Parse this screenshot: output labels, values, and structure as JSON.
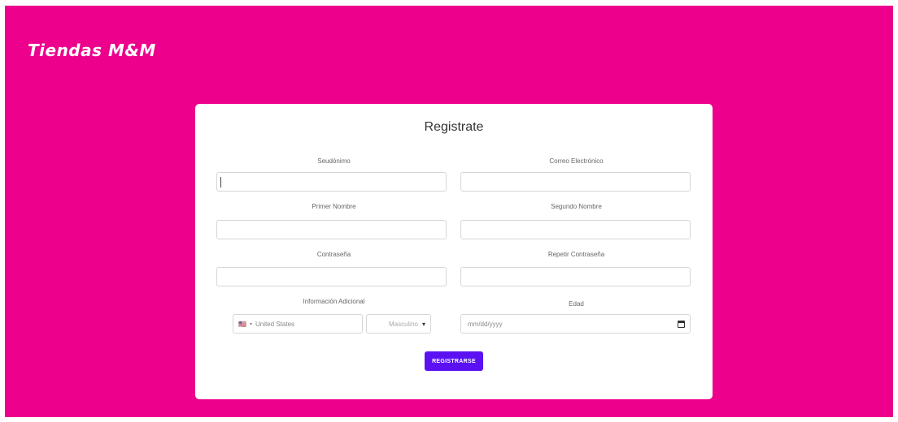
{
  "brand": {
    "name": "Tiendas M&M"
  },
  "form": {
    "title": "Registrate",
    "fields": {
      "username": {
        "label": "Seudónimo",
        "value": ""
      },
      "email": {
        "label": "Correo Electrónico",
        "value": ""
      },
      "first_name": {
        "label": "Primer Nombre",
        "value": ""
      },
      "second_name": {
        "label": "Segundo Nombre",
        "value": ""
      },
      "password": {
        "label": "Contraseña",
        "value": ""
      },
      "repeat_password": {
        "label": "Repetir Contraseña",
        "value": ""
      },
      "additional_info": {
        "label": "Información Adicional"
      },
      "country": {
        "flag": "🇺🇸",
        "value": "United States"
      },
      "gender": {
        "value": "Masculino"
      },
      "age": {
        "label": "Edad",
        "placeholder": "mm/dd/yyyy"
      }
    },
    "submit_label": "REGISTRARSE"
  },
  "colors": {
    "page_background": "#ec008c",
    "button": "#5a12f2",
    "card": "#ffffff"
  }
}
